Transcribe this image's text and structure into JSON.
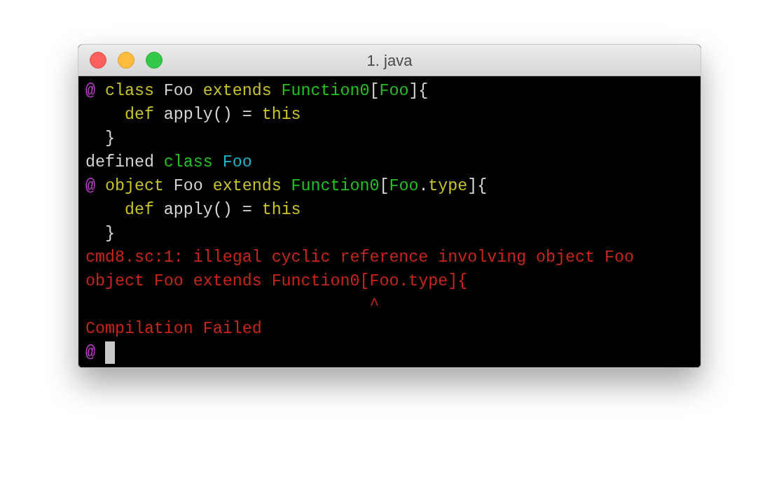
{
  "window": {
    "title": "1. java"
  },
  "lines": [
    {
      "segments": [
        {
          "text": "@",
          "color": "#c43fd3"
        },
        {
          "text": " class",
          "color": "#c8c42a"
        },
        {
          "text": " Foo",
          "color": "#d6d6d6"
        },
        {
          "text": " extends",
          "color": "#c8c42a"
        },
        {
          "text": " Function0",
          "color": "#22c322"
        },
        {
          "text": "[",
          "color": "#d6d6d6"
        },
        {
          "text": "Foo",
          "color": "#22c322"
        },
        {
          "text": "]{",
          "color": "#d6d6d6"
        }
      ]
    },
    {
      "segments": [
        {
          "text": "    def",
          "color": "#c8c42a"
        },
        {
          "text": " apply() =",
          "color": "#d6d6d6"
        },
        {
          "text": " this",
          "color": "#c8c42a"
        }
      ]
    },
    {
      "segments": [
        {
          "text": "  }",
          "color": "#d6d6d6"
        }
      ]
    },
    {
      "segments": [
        {
          "text": "defined",
          "color": "#d6d6d6"
        },
        {
          "text": " class",
          "color": "#22c322"
        },
        {
          "text": " Foo",
          "color": "#1bb8c9"
        }
      ]
    },
    {
      "segments": [
        {
          "text": "@",
          "color": "#c43fd3"
        },
        {
          "text": " object",
          "color": "#c8c42a"
        },
        {
          "text": " Foo",
          "color": "#d6d6d6"
        },
        {
          "text": " extends",
          "color": "#c8c42a"
        },
        {
          "text": " Function0",
          "color": "#22c322"
        },
        {
          "text": "[",
          "color": "#d6d6d6"
        },
        {
          "text": "Foo",
          "color": "#22c322"
        },
        {
          "text": ".",
          "color": "#d6d6d6"
        },
        {
          "text": "type",
          "color": "#c8c42a"
        },
        {
          "text": "]{",
          "color": "#d6d6d6"
        }
      ]
    },
    {
      "segments": [
        {
          "text": "    def",
          "color": "#c8c42a"
        },
        {
          "text": " apply() =",
          "color": "#d6d6d6"
        },
        {
          "text": " this",
          "color": "#c8c42a"
        }
      ]
    },
    {
      "segments": [
        {
          "text": "  }",
          "color": "#d6d6d6"
        }
      ]
    },
    {
      "segments": [
        {
          "text": "cmd8.sc:1: illegal cyclic reference involving object Foo",
          "color": "#c9261b"
        }
      ]
    },
    {
      "segments": [
        {
          "text": "object Foo extends Function0[Foo.type]{",
          "color": "#c9261b"
        }
      ]
    },
    {
      "segments": [
        {
          "text": "                             ^",
          "color": "#c9261b"
        }
      ]
    },
    {
      "segments": [
        {
          "text": "Compilation Failed",
          "color": "#c9261b"
        }
      ]
    },
    {
      "segments": [
        {
          "text": "@",
          "color": "#c43fd3"
        }
      ],
      "cursor": true
    }
  ]
}
